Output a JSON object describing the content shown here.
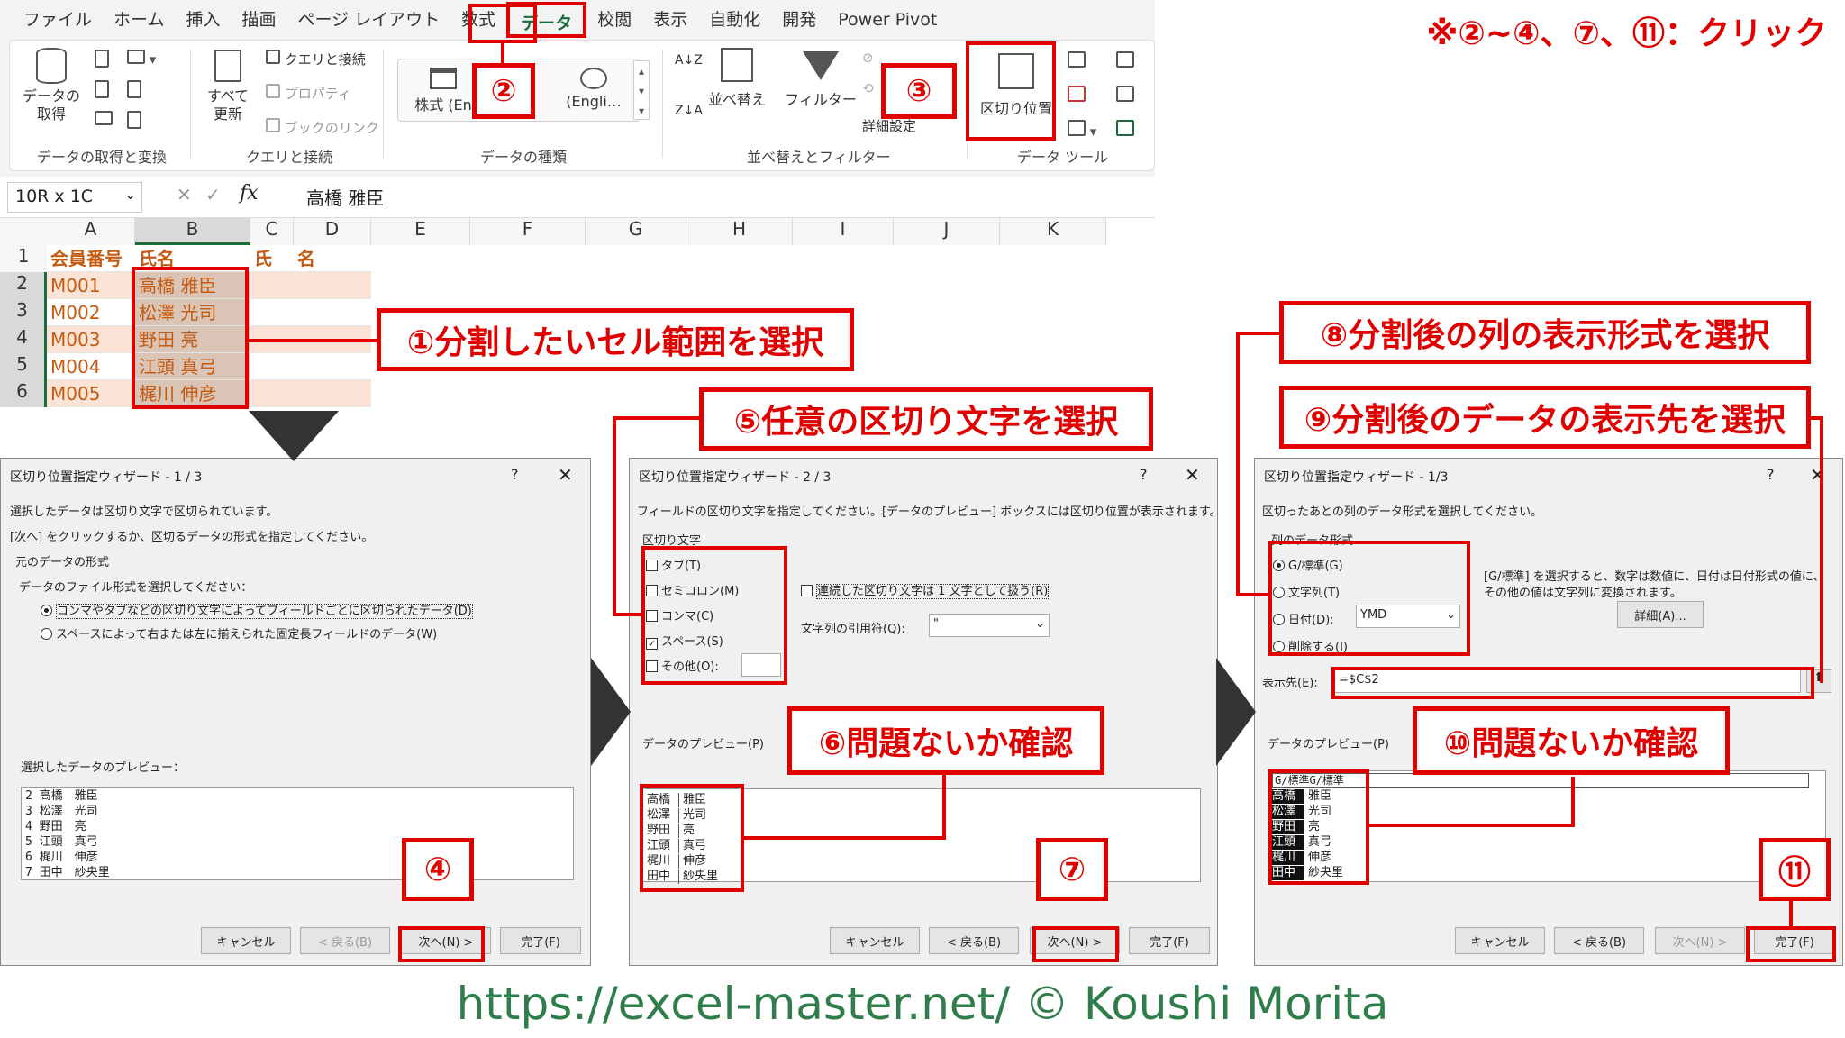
{
  "menu": [
    "ファイル",
    "ホーム",
    "挿入",
    "描画",
    "ページ レイアウト",
    "数式",
    "データ",
    "校閲",
    "表示",
    "自動化",
    "開発",
    "Power Pivot"
  ],
  "ribbon": {
    "get_data": "データの\n取得",
    "get_data_label": "データの取得と変換",
    "refresh_all": "すべて\n更新",
    "queries": "クエリと接続",
    "properties": "プロパティ",
    "book_links": "ブックのリンク",
    "queries_label": "クエリと接続",
    "stocks": "株式 (En",
    "geo": "(Engli…",
    "datatypes_label": "データの種類",
    "sort": "並べ替え",
    "filter": "フィルター",
    "advanced": "詳細設定",
    "sort_filter_label": "並べ替えとフィルター",
    "text_to_columns": "区切り位置",
    "data_tools_label": "データ ツール"
  },
  "formula": {
    "namebox": "10R x 1C",
    "fx": "fx",
    "value": "高橋 雅臣"
  },
  "grid": {
    "cols": [
      "A",
      "B",
      "C",
      "D",
      "E",
      "F",
      "G",
      "H",
      "I",
      "J",
      "K"
    ],
    "rows": [
      "1",
      "2",
      "3",
      "4",
      "5",
      "6"
    ],
    "headers": [
      "会員番号",
      "氏名",
      "氏",
      "名"
    ],
    "ids": [
      "M001",
      "M002",
      "M003",
      "M004",
      "M005"
    ],
    "names": [
      "高橋 雅臣",
      "松澤 光司",
      "野田 亮",
      "江頭 真弓",
      "梶川 伸彦"
    ]
  },
  "note": "※②~④、⑦、⑪：クリック",
  "callouts": {
    "c1": "①分割したいセル範囲を選択",
    "c2": "②",
    "c3": "③",
    "c4": "④",
    "c5": "⑤任意の区切り文字を選択",
    "c6": "⑥問題ないか確認",
    "c7": "⑦",
    "c8": "⑧分割後の列の表示形式を選択",
    "c9": "⑨分割後のデータの表示先を選択",
    "c10": "⑩問題ないか確認",
    "c11": "⑪"
  },
  "dlg1": {
    "title": "区切り位置指定ウィザード - 1 / 3",
    "line1": "選択したデータは区切り文字で区切られています。",
    "line2": "[次へ] をクリックするか、区切るデータの形式を指定してください。",
    "group": "元のデータの形式",
    "prompt": "データのファイル形式を選択してください：",
    "opt1": "コンマやタブなどの区切り文字によってフィールドごとに区切られたデータ(D)",
    "opt2": "スペースによって右または左に揃えられた固定長フィールドのデータ(W)",
    "preview_label": "選択したデータのプレビュー：",
    "preview": [
      "2 高橋　雅臣",
      "3 松澤　光司",
      "4 野田　亮",
      "5 江頭　真弓",
      "6 梶川　伸彦",
      "7 田中　紗央里"
    ],
    "cancel": "キャンセル",
    "back": "< 戻る(B)",
    "next": "次へ(N) >",
    "finish": "完了(F)"
  },
  "dlg2": {
    "title": "区切り位置指定ウィザード - 2 / 3",
    "line1": "フィールドの区切り文字を指定してください。[データのプレビュー] ボックスには区切り位置が表示されます。",
    "group": "区切り文字",
    "tab": "タブ(T)",
    "semicolon": "セミコロン(M)",
    "comma": "コンマ(C)",
    "space": "スペース(S)",
    "other": "その他(O):",
    "consecutive": "連続した区切り文字は 1 文字として扱う(R)",
    "qualifier_label": "文字列の引用符(Q):",
    "qualifier": "\"",
    "preview_label": "データのプレビュー(P)",
    "preview_a": [
      "高橋",
      "松澤",
      "野田",
      "江頭",
      "梶川",
      "田中"
    ],
    "preview_b": [
      "雅臣",
      "光司",
      "亮",
      "真弓",
      "伸彦",
      "紗央里"
    ],
    "cancel": "キャンセル",
    "back": "< 戻る(B)",
    "next": "次へ(N) >",
    "finish": "完了(F)"
  },
  "dlg3": {
    "title": "区切り位置指定ウィザード - 1/3",
    "line1": "区切ったあとの列のデータ形式を選択してください。",
    "group": "列のデータ形式",
    "general": "G/標準(G)",
    "text": "文字列(T)",
    "date": "日付(D):",
    "date_fmt": "YMD",
    "skip": "削除する(I)",
    "desc1": "[G/標準] を選択すると、数字は数値に、日付は日付形式の値に、",
    "desc2": "その他の値は文字列に変換されます。",
    "advanced": "詳細(A)...",
    "dest_label": "表示先(E):",
    "dest": "=$C$2",
    "preview_label": "データのプレビュー(P)",
    "preview_hdr": "G/標準G/標準",
    "preview_a": [
      "高橋",
      "松澤",
      "野田",
      "江頭",
      "梶川",
      "田中"
    ],
    "preview_b": [
      "雅臣",
      "光司",
      "亮",
      "真弓",
      "伸彦",
      "紗央里"
    ],
    "cancel": "キャンセル",
    "back": "< 戻る(B)",
    "next": "次へ(N) >",
    "finish": "完了(F)"
  },
  "footer": "https://excel-master.net/  © Koushi Morita"
}
